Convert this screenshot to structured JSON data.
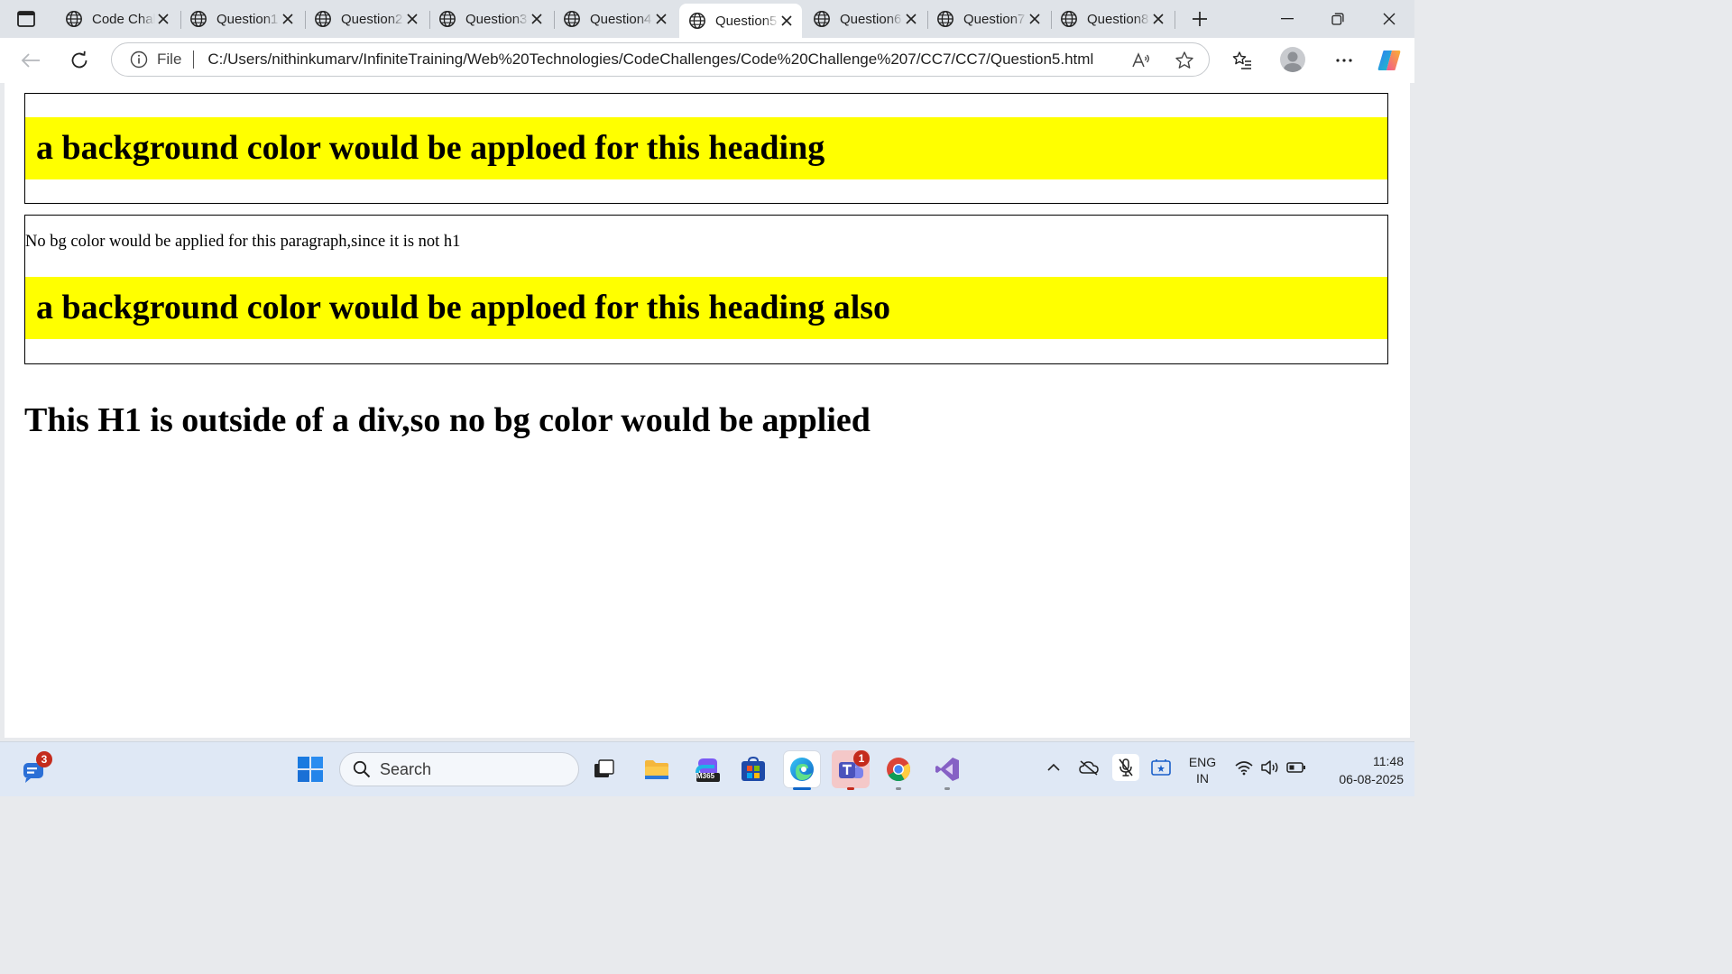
{
  "browser": {
    "tabs": [
      {
        "title": "Code Challenges"
      },
      {
        "title": "Question1"
      },
      {
        "title": "Question2"
      },
      {
        "title": "Question3"
      },
      {
        "title": "Question4"
      },
      {
        "title": "Question5"
      },
      {
        "title": "Question6"
      },
      {
        "title": "Question7"
      },
      {
        "title": "Question8"
      }
    ],
    "active_tab_index": 5,
    "address": {
      "scheme_label": "File",
      "url": "C:/Users/nithinkumarv/InfiniteTraining/Web%20Technologies/CodeChallenges/Code%20Challenge%207/CC7/CC7/Question5.html"
    }
  },
  "page": {
    "box1": {
      "heading": "a background color would be apploed for this heading"
    },
    "box2": {
      "paragraph": "No bg color would be applied for this paragraph,since it is not h1",
      "heading": "a background color would be apploed for this heading also"
    },
    "outside_heading": "This H1 is outside of a div,so no bg color would be applied",
    "highlight_color": "#ffff00"
  },
  "taskbar": {
    "search_placeholder": "Search",
    "notifications_badge": "3",
    "teams_badge": "1",
    "m365_label": "M365",
    "lang_line1": "ENG",
    "lang_line2": "IN",
    "time": "11:48",
    "date": "06-08-2025"
  }
}
